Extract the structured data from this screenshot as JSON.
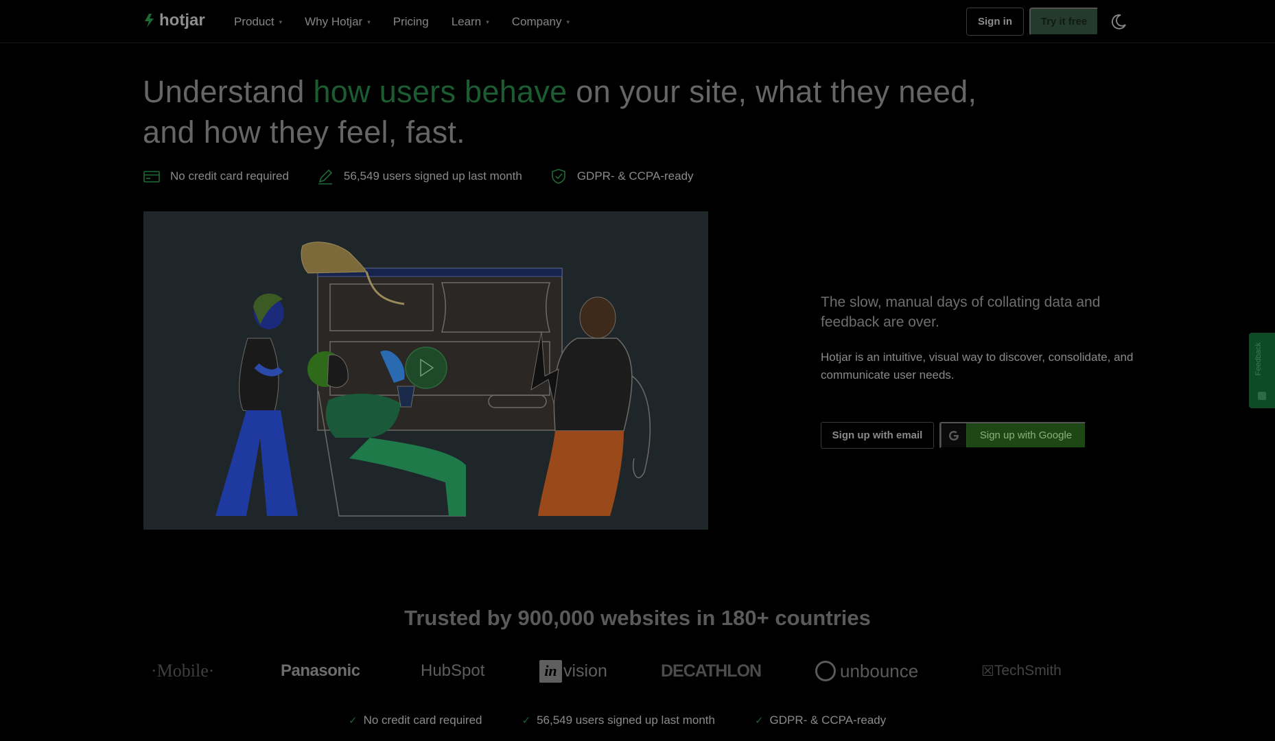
{
  "nav": {
    "logo_text": "hotjar",
    "links": [
      {
        "label": "Product",
        "has_caret": true
      },
      {
        "label": "Why Hotjar",
        "has_caret": true
      },
      {
        "label": "Pricing",
        "has_caret": false
      },
      {
        "label": "Learn",
        "has_caret": true
      },
      {
        "label": "Company",
        "has_caret": true
      }
    ],
    "signin_label": "Sign in",
    "try_label": "Try it free",
    "theme_icon": "moon-icon"
  },
  "hero": {
    "headline_pre": "Understand ",
    "headline_accent": "how users behave",
    "headline_post": " on your site, what they need, and how they feel, fast.",
    "badges": [
      {
        "icon": "credit-card-icon",
        "label": "No credit card required"
      },
      {
        "icon": "pencil-icon",
        "label": "56,549 users signed up last month"
      },
      {
        "icon": "shield-check-icon",
        "label": "GDPR- & CCPA-ready"
      }
    ],
    "video_icon": "play-icon",
    "side_title": "The slow, manual days of collating data and feedback are over.",
    "side_text": "Hotjar is an intuitive, visual way to discover, consolidate, and communicate user needs.",
    "signup_email_label": "Sign up with email",
    "signup_google_label": "Sign up with Google"
  },
  "feedback_tab": {
    "label": "Feedback"
  },
  "trusted": {
    "title": "Trusted by 900,000 websites in 180+ countries",
    "logos": {
      "tmobile": "·Mobile·",
      "panasonic": "Panasonic",
      "hubspot": "HubSpot",
      "invision_box": "in",
      "invision_text": "vision",
      "decathlon": "DECATHLON",
      "unbounce": "unbounce",
      "techsmith": "TechSmith"
    }
  },
  "bottom_badges": [
    "No credit card required",
    "56,549 users signed up last month",
    "GDPR- & CCPA-ready"
  ],
  "colors": {
    "background": "#000000",
    "accent_green": "#1c5c32",
    "google_button": "#1d4816",
    "video_bg": "#1f262a"
  }
}
